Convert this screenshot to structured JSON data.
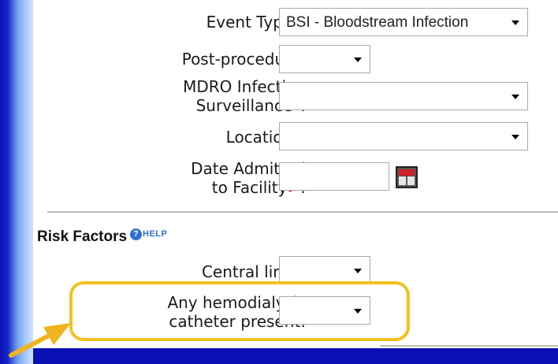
{
  "form": {
    "event_type": {
      "label": "Event Type",
      "required_mark": "*",
      "suffix": ":",
      "value": "BSI - Bloodstream Infection"
    },
    "post_procedure": {
      "label": "Post-procedure:",
      "value": ""
    },
    "mdro": {
      "label_line1": "MDRO Infection",
      "label_line2": "Surveillance",
      "required_mark": "*",
      "suffix": ":",
      "value": ""
    },
    "location": {
      "label": "Location",
      "required_mark": "*",
      "suffix": ":",
      "value": ""
    },
    "date_admitted": {
      "label_line1": "Date Admitted",
      "label_line2": "to Facility",
      "required_mark": ">",
      "suffix": ":",
      "value": ""
    }
  },
  "risk_factors": {
    "title": "Risk Factors",
    "help_label": "HELP",
    "help_icon_glyph": "?",
    "central_line": {
      "label": "Central line",
      "required_mark": "*",
      "suffix": ":",
      "value": ""
    },
    "hemodialysis": {
      "label_line1": "Any hemodialysis",
      "label_line2": "catheter present:",
      "value": ""
    }
  },
  "colors": {
    "background": "#0a0fb4",
    "required": "#e8202a",
    "highlight": "#f0c21e",
    "arrow": "#f0b41e",
    "help": "#2f6fcf"
  },
  "icons": {
    "dropdown": "chevron-down-icon",
    "calendar": "calendar-icon",
    "help": "help-icon",
    "annotation_arrow": "arrow-icon"
  }
}
